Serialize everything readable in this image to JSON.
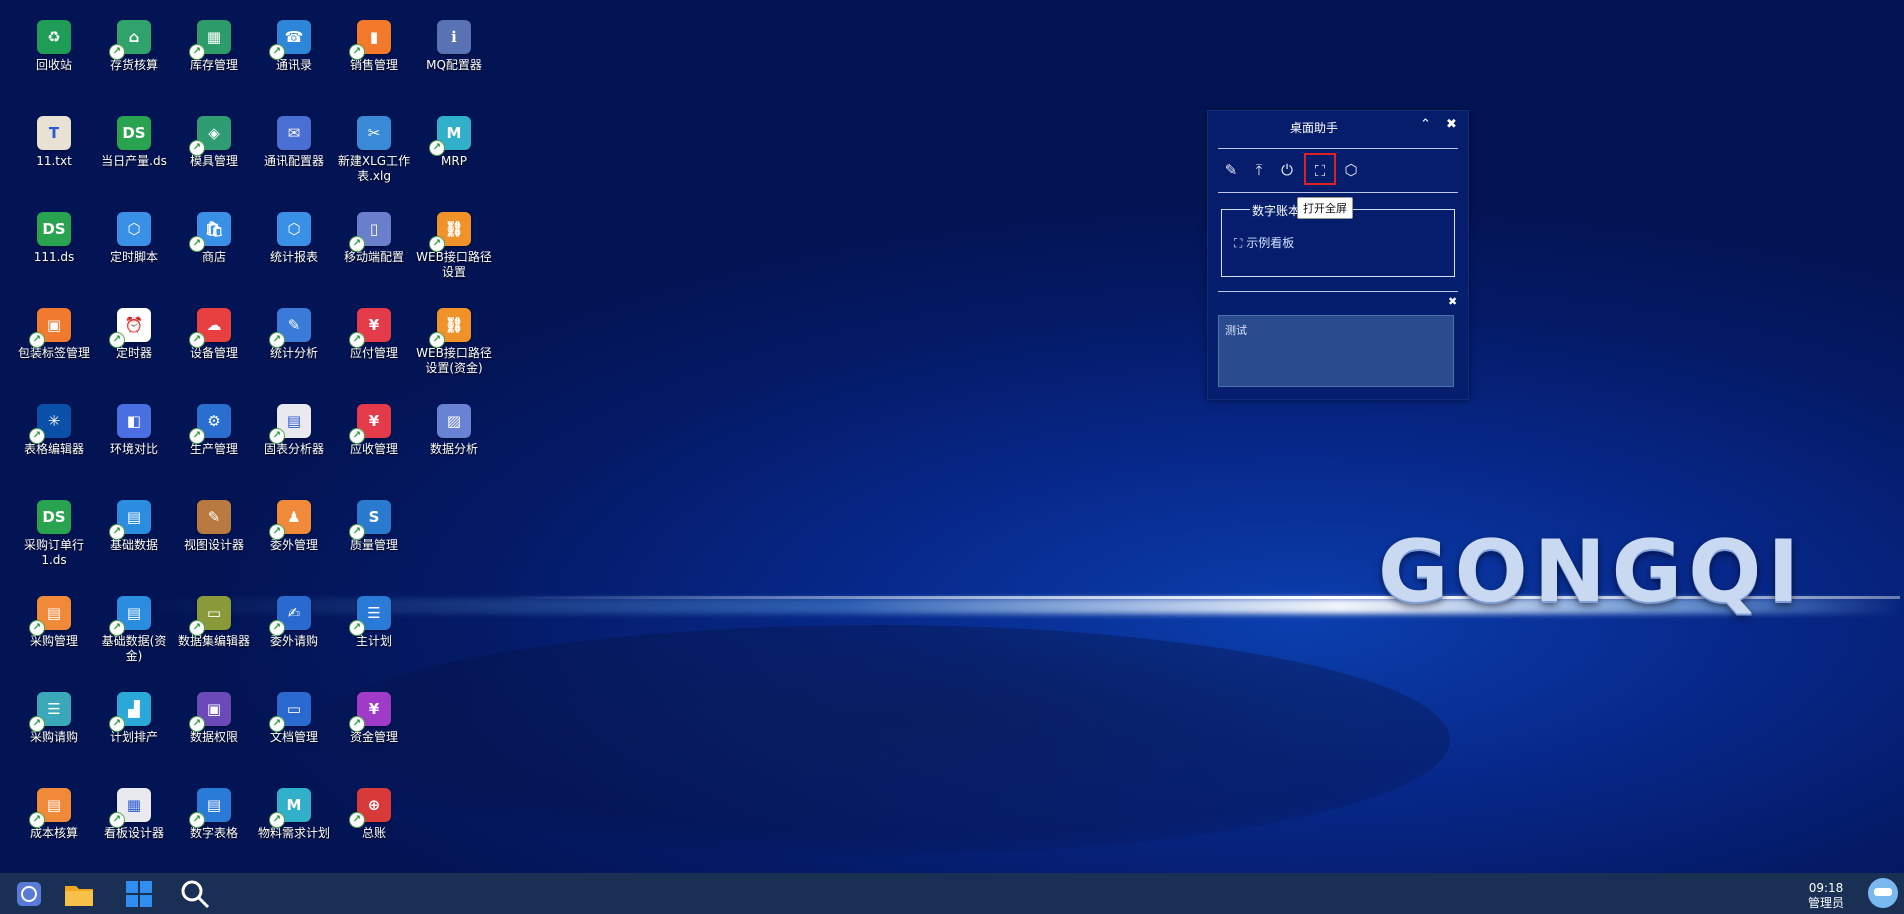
{
  "desktop_icons": [
    {
      "label": "回收站",
      "icon": "recycle-bin-icon",
      "color": "#1f9d57",
      "sym": "♻",
      "link": false
    },
    {
      "label": "存货核算",
      "icon": "inventory-accounting-icon",
      "color": "#2fa36b",
      "sym": "⌂",
      "link": true
    },
    {
      "label": "库存管理",
      "icon": "stock-management-icon",
      "color": "#2e9c6a",
      "sym": "▦",
      "link": true
    },
    {
      "label": "通讯录",
      "icon": "contacts-icon",
      "color": "#2d86d8",
      "sym": "☎",
      "link": true
    },
    {
      "label": "销售管理",
      "icon": "sales-management-icon",
      "color": "#f27a2a",
      "sym": "▮",
      "link": true
    },
    {
      "label": "MQ配置器",
      "icon": "mq-config-icon",
      "color": "#5872b4",
      "sym": "ℹ",
      "link": false
    },
    {
      "label": "11.txt",
      "icon": "text-file-icon",
      "color": "#e8e1d4",
      "sym": "T",
      "link": false
    },
    {
      "label": "当日产量.ds",
      "icon": "ds-file-icon",
      "color": "#2aa350",
      "sym": "DS",
      "link": false
    },
    {
      "label": "模具管理",
      "icon": "mold-management-icon",
      "color": "#2f9c72",
      "sym": "◈",
      "link": true
    },
    {
      "label": "通讯配置器",
      "icon": "comm-config-icon",
      "color": "#4a6fd4",
      "sym": "✉",
      "link": false
    },
    {
      "label": "新建XLG工作表.xlg",
      "icon": "xlg-file-icon",
      "color": "#3a8ad8",
      "sym": "✂",
      "link": false
    },
    {
      "label": "MRP",
      "icon": "mrp-icon",
      "color": "#31b0c9",
      "sym": "M",
      "link": true
    },
    {
      "label": "111.ds",
      "icon": "ds-file-icon",
      "color": "#2aa350",
      "sym": "DS",
      "link": false
    },
    {
      "label": "定时脚本",
      "icon": "timer-script-icon",
      "color": "#3a8fe6",
      "sym": "⬡",
      "link": false
    },
    {
      "label": "商店",
      "icon": "store-icon",
      "color": "#3a8fe6",
      "sym": "🛍",
      "link": true
    },
    {
      "label": "统计报表",
      "icon": "stat-report-icon",
      "color": "#3a8fe6",
      "sym": "⬡",
      "link": false
    },
    {
      "label": "移动端配置",
      "icon": "mobile-config-icon",
      "color": "#6a7fcc",
      "sym": "▯",
      "link": true
    },
    {
      "label": "WEB接口路径设置",
      "icon": "web-api-path-icon",
      "color": "#f0922a",
      "sym": "⛓",
      "link": true
    },
    {
      "label": "包装标签管理",
      "icon": "package-label-icon",
      "color": "#f07a30",
      "sym": "▣",
      "link": true
    },
    {
      "label": "定时器",
      "icon": "timer-icon",
      "color": "#ffffff",
      "sym": "⏰",
      "link": true
    },
    {
      "label": "设备管理",
      "icon": "equipment-management-icon",
      "color": "#e84040",
      "sym": "☁",
      "link": true
    },
    {
      "label": "统计分析",
      "icon": "stat-analysis-icon",
      "color": "#3a7ad8",
      "sym": "✎",
      "link": true
    },
    {
      "label": "应付管理",
      "icon": "payable-management-icon",
      "color": "#e43a4a",
      "sym": "¥",
      "link": true
    },
    {
      "label": "WEB接口路径设置(资金)",
      "icon": "web-api-path-fund-icon",
      "color": "#f0922a",
      "sym": "⛓",
      "link": true
    },
    {
      "label": "表格编辑器",
      "icon": "table-editor-icon",
      "color": "#0a4fa8",
      "sym": "✳",
      "link": true
    },
    {
      "label": "环境对比",
      "icon": "env-compare-icon",
      "color": "#4a6fe0",
      "sym": "◧",
      "link": false
    },
    {
      "label": "生产管理",
      "icon": "production-management-icon",
      "color": "#2a6fd0",
      "sym": "⚙",
      "link": true
    },
    {
      "label": "固表分析器",
      "icon": "report-analyzer-icon",
      "color": "#e8eaf0",
      "sym": "▤",
      "link": true
    },
    {
      "label": "应收管理",
      "icon": "receivable-management-icon",
      "color": "#e43a4a",
      "sym": "¥",
      "link": true
    },
    {
      "label": "数据分析",
      "icon": "data-analysis-icon",
      "color": "#6a82d4",
      "sym": "▨",
      "link": false
    },
    {
      "label": "采购订单行1.ds",
      "icon": "ds-file-icon",
      "color": "#2aa350",
      "sym": "DS",
      "link": false
    },
    {
      "label": "基础数据",
      "icon": "base-data-icon",
      "color": "#2a8de0",
      "sym": "▤",
      "link": true
    },
    {
      "label": "视图设计器",
      "icon": "view-designer-icon",
      "color": "#b87a40",
      "sym": "✎",
      "link": false
    },
    {
      "label": "委外管理",
      "icon": "outsourcing-management-icon",
      "color": "#f08a3a",
      "sym": "♟",
      "link": true
    },
    {
      "label": "质量管理",
      "icon": "quality-management-icon",
      "color": "#2a7ad0",
      "sym": "S",
      "link": true
    },
    {
      "label": "采购管理",
      "icon": "purchase-management-icon",
      "color": "#f08a3a",
      "sym": "▤",
      "link": true
    },
    {
      "label": "基础数据(资金)",
      "icon": "base-data-fund-icon",
      "color": "#2a8de0",
      "sym": "▤",
      "link": true
    },
    {
      "label": "数据集编辑器",
      "icon": "dataset-editor-icon",
      "color": "#8a9a3a",
      "sym": "▭",
      "link": true
    },
    {
      "label": "委外请购",
      "icon": "outsourcing-request-icon",
      "color": "#2a6ad0",
      "sym": "✍",
      "link": true
    },
    {
      "label": "主计划",
      "icon": "master-plan-icon",
      "color": "#2a7ad8",
      "sym": "☰",
      "link": true
    },
    {
      "label": "采购请购",
      "icon": "purchase-request-icon",
      "color": "#3aa8b8",
      "sym": "☰",
      "link": true
    },
    {
      "label": "计划排产",
      "icon": "plan-scheduling-icon",
      "color": "#2aa8d8",
      "sym": "▟",
      "link": true
    },
    {
      "label": "数据权限",
      "icon": "data-permission-icon",
      "color": "#6a4ab8",
      "sym": "▣",
      "link": true
    },
    {
      "label": "文档管理",
      "icon": "document-management-icon",
      "color": "#2a6ad0",
      "sym": "▭",
      "link": true
    },
    {
      "label": "资金管理",
      "icon": "fund-management-icon",
      "color": "#a03ac8",
      "sym": "¥",
      "link": true
    },
    {
      "label": "成本核算",
      "icon": "cost-accounting-icon",
      "color": "#f08a3a",
      "sym": "▤",
      "link": true
    },
    {
      "label": "看板设计器",
      "icon": "board-designer-icon",
      "color": "#e8eaf0",
      "sym": "▦",
      "link": true
    },
    {
      "label": "数字表格",
      "icon": "digital-table-icon",
      "color": "#2a7ad8",
      "sym": "▤",
      "link": true
    },
    {
      "label": "物料需求计划",
      "icon": "material-plan-icon",
      "color": "#31b0c9",
      "sym": "M",
      "link": true
    },
    {
      "label": "总账",
      "icon": "general-ledger-icon",
      "color": "#d83a3a",
      "sym": "⊕",
      "link": true
    }
  ],
  "assistant": {
    "title": "桌面助手",
    "collapse_icon": "chevron-up-icon",
    "close_icon": "close-icon",
    "tools": [
      {
        "name": "edit-icon",
        "sym": "✎"
      },
      {
        "name": "pin-top-icon",
        "sym": "⤒"
      },
      {
        "name": "power-icon",
        "sym": "⏻"
      },
      {
        "name": "fullscreen-icon",
        "sym": "⛶"
      },
      {
        "name": "cube-icon",
        "sym": "⬡"
      }
    ],
    "tooltip": "打开全屏",
    "group_title": "数字账本",
    "group_item": "示例看板",
    "notes_close": "✖",
    "notes_text": "测试"
  },
  "brand": "GONGQI",
  "taskbar": {
    "time": "09:18",
    "user": "管理员"
  }
}
